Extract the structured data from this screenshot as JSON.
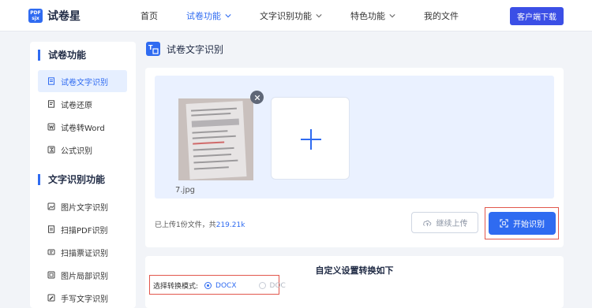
{
  "app": {
    "logo_mark_top": "PDF",
    "logo_mark_bottom": "sjx",
    "name": "试卷星"
  },
  "nav": {
    "items": [
      {
        "label": "首页",
        "active": false,
        "dropdown": false
      },
      {
        "label": "试卷功能",
        "active": true,
        "dropdown": true
      },
      {
        "label": "文字识别功能",
        "active": false,
        "dropdown": true
      },
      {
        "label": "特色功能",
        "active": false,
        "dropdown": true
      },
      {
        "label": "我的文件",
        "active": false,
        "dropdown": false
      }
    ],
    "download_label": "客户端下载"
  },
  "sidebar": {
    "section1_title": "试卷功能",
    "section1_items": [
      {
        "label": "试卷文字识别",
        "icon": "doc-scan-icon",
        "active": true
      },
      {
        "label": "试卷还原",
        "icon": "doc-restore-icon",
        "active": false
      },
      {
        "label": "试卷转Word",
        "icon": "word-icon",
        "active": false
      },
      {
        "label": "公式识别",
        "icon": "formula-icon",
        "active": false
      }
    ],
    "section2_title": "文字识别功能",
    "section2_items": [
      {
        "label": "图片文字识别",
        "icon": "image-icon",
        "active": false
      },
      {
        "label": "扫描PDF识别",
        "icon": "pdf-icon",
        "active": false
      },
      {
        "label": "扫描票证识别",
        "icon": "ticket-icon",
        "active": false
      },
      {
        "label": "图片局部识别",
        "icon": "crop-icon",
        "active": false
      },
      {
        "label": "手写文字识别",
        "icon": "handwriting-icon",
        "active": false
      }
    ]
  },
  "page": {
    "title": "试卷文字识别"
  },
  "upload": {
    "file_name": "7.jpg",
    "info_prefix": "已上传1份文件，共",
    "total_size": "219.21k",
    "continue_label": "继续上传",
    "start_label": "开始识别"
  },
  "settings": {
    "title": "自定义设置转换如下",
    "mode_label": "选择转换模式:",
    "options": [
      {
        "label": "DOCX",
        "selected": true
      },
      {
        "label": "DOC",
        "selected": false
      }
    ]
  },
  "colors": {
    "primary": "#2f6bf1",
    "highlight_frame": "#e2574c",
    "download_btn": "#3b4fe6"
  }
}
